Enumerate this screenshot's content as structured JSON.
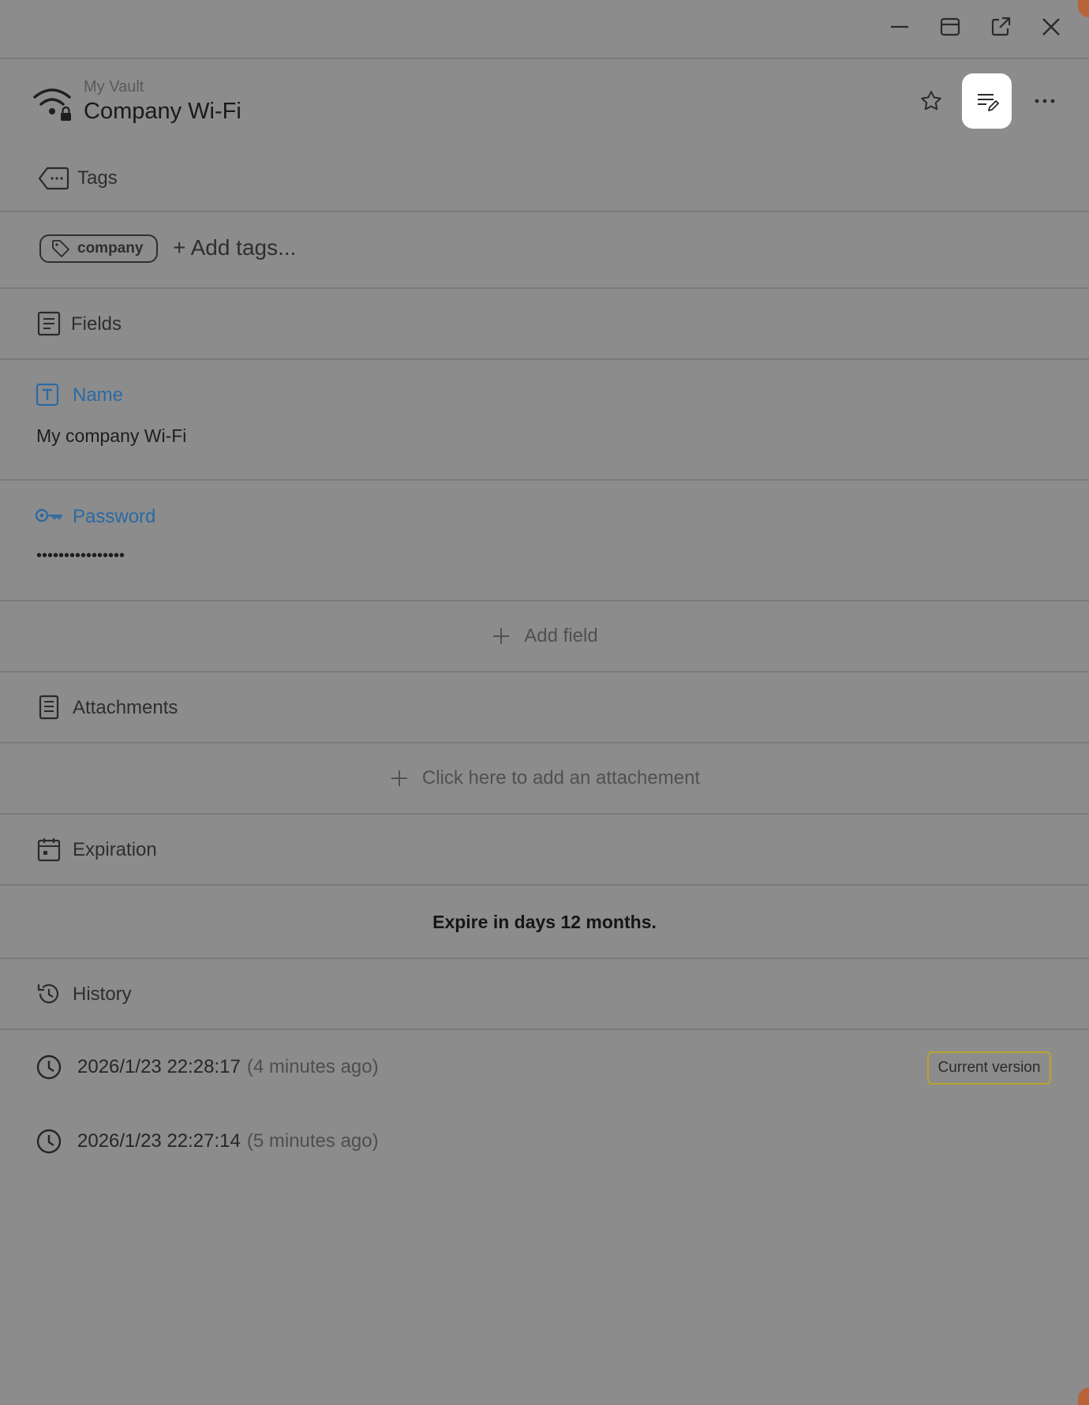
{
  "window_controls": {
    "minimize_icon": "minimize-icon",
    "maximize_icon": "maximize-icon",
    "popout_icon": "external-link-icon",
    "close_icon": "close-icon"
  },
  "header": {
    "vault_name": "My Vault",
    "item_title": "Company Wi-Fi",
    "item_icon": "wifi-lock-icon"
  },
  "tags": {
    "section_title": "Tags",
    "items": [
      "company"
    ],
    "add_label": "+ Add tags..."
  },
  "fields": {
    "section_title": "Fields",
    "items": [
      {
        "label": "Name",
        "value": "My company Wi-Fi",
        "icon": "text-field-icon"
      },
      {
        "label": "Password",
        "value": "••••••••••••••••",
        "icon": "key-icon"
      }
    ],
    "add_label": "Add field"
  },
  "attachments": {
    "section_title": "Attachments",
    "add_label": "Click here to add an attachement"
  },
  "expiration": {
    "section_title": "Expiration",
    "text": "Expire in days 12 months."
  },
  "history": {
    "section_title": "History",
    "entries": [
      {
        "time": "2026/1/23 22:28:17",
        "ago": "(4 minutes ago)",
        "badge": "Current version"
      },
      {
        "time": "2026/1/23 22:27:14",
        "ago": "(5 minutes ago)",
        "badge": ""
      }
    ]
  },
  "colors": {
    "overlay_background": "#8c8c8c",
    "field_label": "#2b6aa3",
    "badge_border": "#b9a52e",
    "edit_button_bg": "#ffffff"
  }
}
